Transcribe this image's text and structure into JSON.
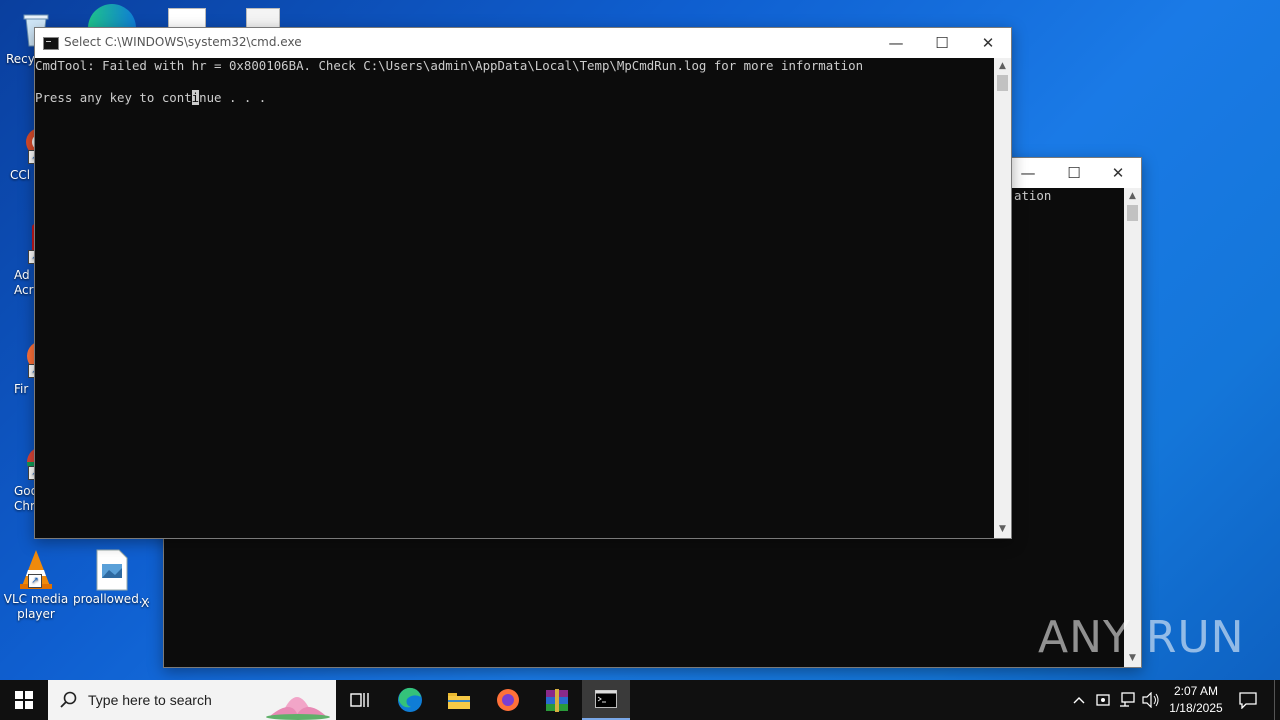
{
  "desktop": {
    "icons": [
      {
        "label": "Recy"
      },
      {
        "label": "CCl"
      },
      {
        "label": "Ad\nAcr"
      },
      {
        "label": "Fir"
      },
      {
        "label": "Goo\nChr"
      },
      {
        "label": "VLC media\nplayer"
      },
      {
        "label": "proallowed..."
      },
      {
        "label": "X"
      }
    ]
  },
  "front_window": {
    "title": "Select C:\\WINDOWS\\system32\\cmd.exe",
    "line1": "CmdTool: Failed with hr = 0x800106BA. Check C:\\Users\\admin\\AppData\\Local\\Temp\\MpCmdRun.log for more information",
    "line2_before": "Press any key to cont",
    "line2_cursor": "i",
    "line2_after": "nue . . ."
  },
  "back_window": {
    "visible_text": "ation"
  },
  "taskbar": {
    "search_placeholder": "Type here to search",
    "time": "2:07 AM",
    "date": "1/18/2025"
  },
  "watermark": {
    "text": "ANY RUN"
  },
  "colors": {
    "console_bg": "#0c0c0c",
    "console_fg": "#cccccc",
    "taskbar_bg": "#101010"
  }
}
